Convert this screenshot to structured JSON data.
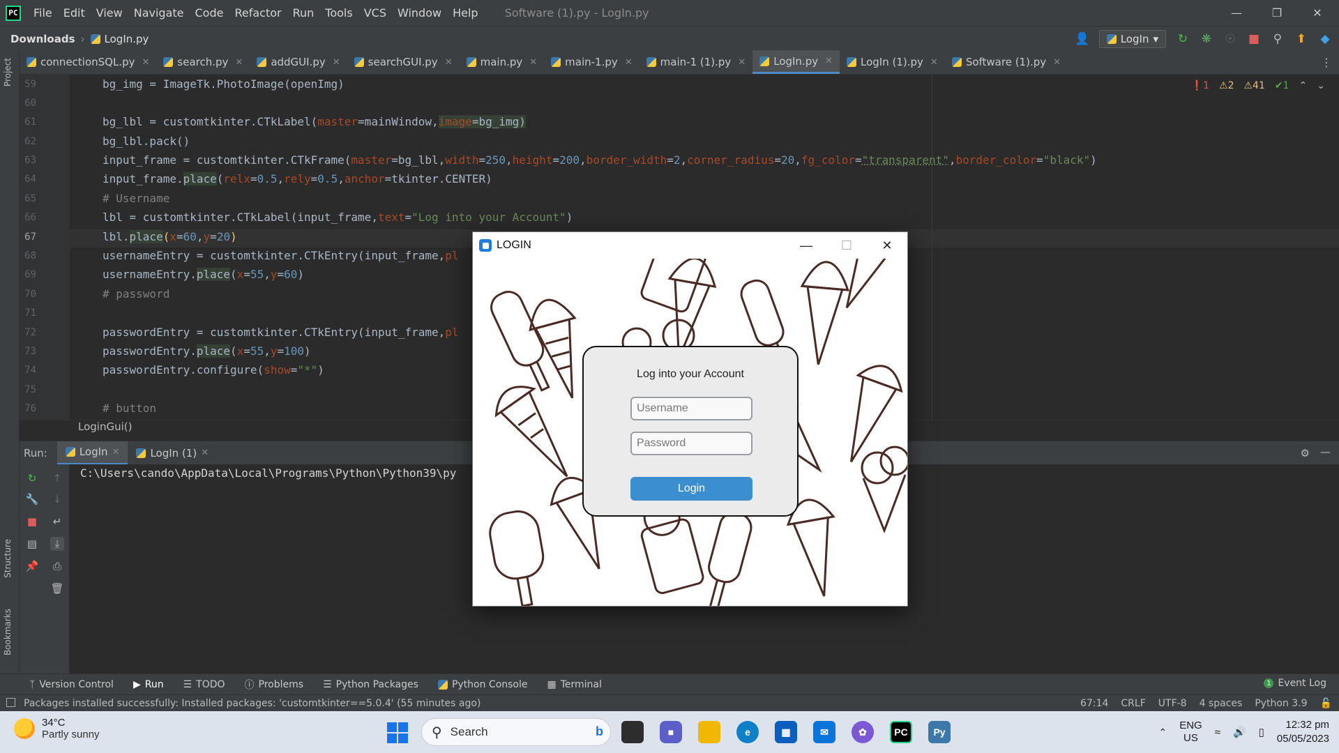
{
  "menubar": {
    "items": [
      "File",
      "Edit",
      "View",
      "Navigate",
      "Code",
      "Refactor",
      "Run",
      "Tools",
      "VCS",
      "Window",
      "Help"
    ],
    "window_title": "Software (1).py - LogIn.py"
  },
  "toolbar": {
    "crumb_root": "Downloads",
    "crumb_file": "LogIn.py",
    "run_config": "LogIn"
  },
  "tabs": [
    "connectionSQL.py",
    "search.py",
    "addGUI.py",
    "searchGUI.py",
    "main.py",
    "main-1.py",
    "main-1 (1).py",
    "LogIn.py",
    "LogIn (1).py",
    "Software (1).py"
  ],
  "active_tab": "LogIn.py",
  "left_strip": {
    "project": "Project",
    "structure": "Structure",
    "bookmarks": "Bookmarks"
  },
  "inspections": {
    "errors": "1",
    "warnings": "2",
    "weak": "41",
    "ok": "1"
  },
  "editor": {
    "lines": [
      "59",
      "60",
      "61",
      "62",
      "63",
      "64",
      "65",
      "66",
      "67",
      "68",
      "69",
      "70",
      "71",
      "72",
      "73",
      "74",
      "75",
      "76"
    ],
    "current_line": "67",
    "function_crumb": "LoginGui()"
  },
  "code": {
    "l59_a": "bg_img = ImageTk.PhotoImage(openImg)",
    "l61_a": "bg_lbl = customtkinter.CTkLabel(",
    "l61_p1": "master",
    "l61_b": "=mainWindow,",
    "l61_p2": "image",
    "l61_c": "=bg_img)",
    "l62": "bg_lbl.pack()",
    "l63_a": "input_frame = customtkinter.CTkFrame(",
    "l63_p1": "master",
    "l63_b": "=bg_lbl,",
    "l63_p2": "width",
    "l63_eq1": "=",
    "l63_n1": "250",
    "l63_c1": ",",
    "l63_p3": "height",
    "l63_eq2": "=",
    "l63_n2": "200",
    "l63_c2": ",",
    "l63_p4": "border_width",
    "l63_eq3": "=",
    "l63_n3": "2",
    "l63_c3": ",",
    "l63_p5": "corner_radius",
    "l63_eq4": "=",
    "l63_n4": "20",
    "l63_c4": ",",
    "l63_p6": "fg_color",
    "l63_eq5": "=",
    "l63_s1": "\"transparent\"",
    "l63_c5": ",",
    "l63_p7": "border_color",
    "l63_eq6": "=",
    "l63_s2": "\"black\"",
    "l63_end": ")",
    "l64_a": "input_frame.",
    "l64_fn": "place",
    "l64_b": "(",
    "l64_p1": "relx",
    "l64_eq1": "=",
    "l64_n1": "0.5",
    "l64_c1": ",",
    "l64_p2": "rely",
    "l64_eq2": "=",
    "l64_n2": "0.5",
    "l64_c2": ",",
    "l64_p3": "anchor",
    "l64_end": "=tkinter.CENTER)",
    "l65": "# Username",
    "l66_a": "lbl = customtkinter.CTkLabel(input_frame,",
    "l66_p1": "text",
    "l66_eq": "=",
    "l66_s": "\"Log into your Account\"",
    "l66_end": ")",
    "l67_a": "lbl.",
    "l67_fn": "place",
    "l67_b": "(",
    "l67_p1": "x",
    "l67_eq1": "=",
    "l67_n1": "60",
    "l67_c": ",",
    "l67_p2": "y",
    "l67_eq2": "=",
    "l67_n2": "20",
    "l67_end": ")",
    "l68_a": "usernameEntry = customtkinter.CTkEntry(input_frame,",
    "l68_p": "pl",
    "l69_a": "usernameEntry.",
    "l69_fn": "place",
    "l69_b": "(",
    "l69_p1": "x",
    "l69_eq1": "=",
    "l69_n1": "55",
    "l69_c": ",",
    "l69_p2": "y",
    "l69_eq2": "=",
    "l69_n2": "60",
    "l69_end": ")",
    "l70": "# password",
    "l72_a": "passwordEntry = customtkinter.CTkEntry(input_frame,",
    "l72_p": "pl",
    "l73_a": "passwordEntry.",
    "l73_fn": "place",
    "l73_b": "(",
    "l73_p1": "x",
    "l73_eq1": "=",
    "l73_n1": "55",
    "l73_c": ",",
    "l73_p2": "y",
    "l73_eq2": "=",
    "l73_n2": "100",
    "l73_end": ")",
    "l74_a": "passwordEntry.configure(",
    "l74_p": "show",
    "l74_eq": "=",
    "l74_s": "\"*\"",
    "l74_end": ")",
    "l76": "# button"
  },
  "run_panel": {
    "label": "Run:",
    "tabs": [
      "LogIn",
      "LogIn (1)"
    ],
    "console": "C:\\Users\\cando\\AppData\\Local\\Programs\\Python\\Python39\\py"
  },
  "tool_tabs": [
    "Version Control",
    "Run",
    "TODO",
    "Problems",
    "Python Packages",
    "Python Console",
    "Terminal"
  ],
  "event_log": {
    "count": "1",
    "label": "Event Log"
  },
  "statusbar": {
    "message": "Packages installed successfully: Installed packages: 'customtkinter==5.0.4' (55 minutes ago)",
    "position": "67:14",
    "line_sep": "CRLF",
    "encoding": "UTF-8",
    "indent": "4 spaces",
    "interpreter": "Python 3.9"
  },
  "dialog": {
    "title": "LOGIN",
    "frame_title": "Log into your Account",
    "username_placeholder": "Username",
    "password_placeholder": "Password",
    "login_label": "Login"
  },
  "taskbar": {
    "temp": "34°C",
    "weather": "Partly sunny",
    "search": "Search",
    "lang1": "ENG",
    "lang2": "US",
    "time": "12:32 pm",
    "date": "05/05/2023"
  },
  "colors": {
    "accent": "#4a88c7",
    "login_button": "#3b8ed0",
    "ide_bg": "#2b2b2b"
  }
}
